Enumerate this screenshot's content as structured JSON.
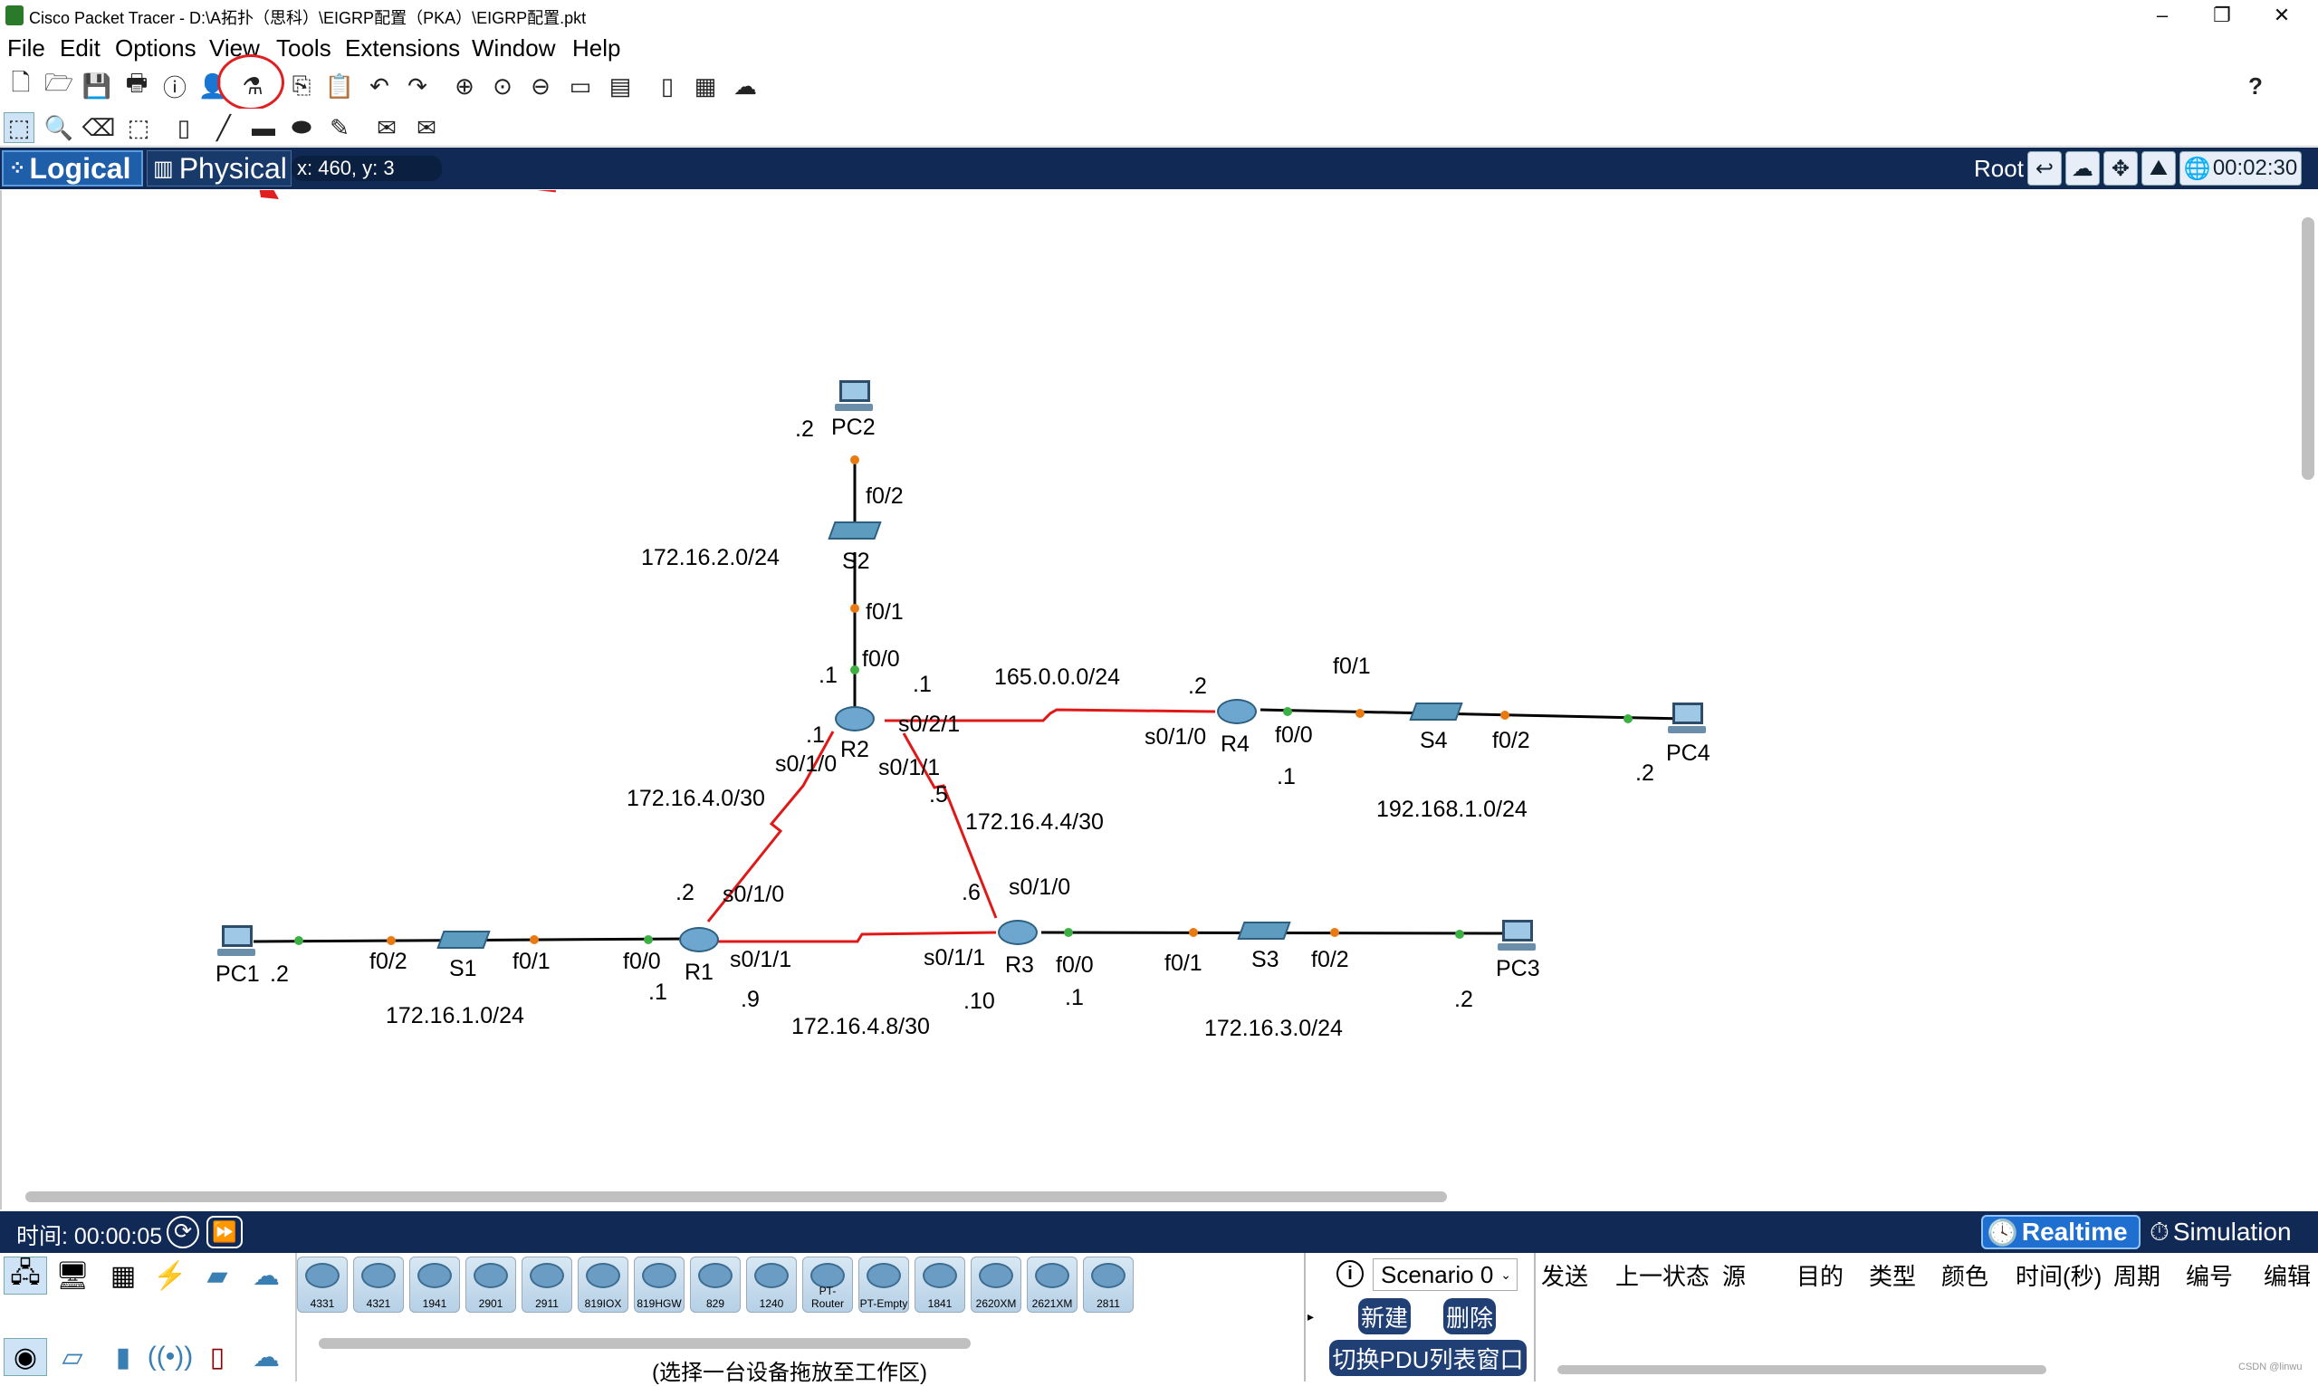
{
  "window": {
    "title": "Cisco Packet Tracer - D:\\A拓扑（思科）\\EIGRP配置（PKA）\\EIGRP配置.pkt",
    "minimize": "–",
    "restore": "❐",
    "close": "✕"
  },
  "menu": [
    "File",
    "Edit",
    "Options",
    "View",
    "Tools",
    "Extensions",
    "Window",
    "Help"
  ],
  "help_icon": "?",
  "modes": {
    "logical": "Logical",
    "physical": "Physical"
  },
  "coords": "x: 460, y: 3",
  "root_label": "Root",
  "clock": "00:02:30",
  "topology": {
    "devices": {
      "PC2": "PC2",
      "S2": "S2",
      "R2": "R2",
      "R4": "R4",
      "S4": "S4",
      "PC4": "PC4",
      "R1": "R1",
      "S1": "S1",
      "PC1": "PC1",
      "R3": "R3",
      "S3": "S3",
      "PC3": "PC3"
    },
    "labels": {
      "pc2_ip": ".2",
      "s2_f02": "f0/2",
      "net_2": "172.16.2.0/24",
      "s2_f01": "f0/1",
      "r2_f00": "f0/0",
      "r2_f00_ip": ".1",
      "r2_s021_ip": ".1",
      "net_165": "165.0.0.0/24",
      "r4_ip": ".2",
      "s4_f01": "f0/1",
      "r2_s021": "s0/2/1",
      "r2_s010_ip": ".1",
      "r2_s010": "s0/1/0",
      "r2_s011": "s0/1/1",
      "r4_s010": "s0/1/0",
      "r4_f00": "f0/0",
      "s4_f02": "f0/2",
      "pc4_ip": ".2",
      "r4_f00_ip": ".1",
      "net_192": "192.168.1.0/24",
      "net_4_0": "172.16.4.0/30",
      "r2_s011_ip": ".5",
      "net_4_4": "172.16.4.4/30",
      "r1_s010_ip": ".2",
      "r1_s010": "s0/1/0",
      "r3_s010_ip": ".6",
      "r3_s010": "s0/1/0",
      "pc1_ip": ".2",
      "s1_f02": "f0/2",
      "s1_f01": "f0/1",
      "r1_f00": "f0/0",
      "r1_s011": "s0/1/1",
      "r3_s011": "s0/1/1",
      "r3_f00": "f0/0",
      "s3_f01": "f0/1",
      "s3_f02": "f0/2",
      "r1_f00_ip": ".1",
      "r1_s011_ip": ".9",
      "r3_s011_ip": ".10",
      "r3_f00_ip": ".1",
      "pc3_ip": ".2",
      "net_1": "172.16.1.0/24",
      "net_4_8": "172.16.4.8/30",
      "net_3": "172.16.3.0/24"
    }
  },
  "timebar": {
    "time": "时间: 00:00:05",
    "realtime": "Realtime",
    "simulation": "Simulation"
  },
  "device_models": [
    "4331",
    "4321",
    "1941",
    "2901",
    "2911",
    "819IOX",
    "819HGW",
    "829",
    "1240",
    "PT-Router",
    "PT-Empty",
    "1841",
    "2620XM",
    "2621XM",
    "2811"
  ],
  "device_hint": "(选择一台设备拖放至工作区)",
  "pdu": {
    "scenario": "Scenario 0",
    "new": "新建",
    "delete": "删除",
    "toggle": "切换PDU列表窗口",
    "columns": [
      "发送",
      "上一状态",
      "源",
      "目的",
      "类型",
      "颜色",
      "时间(秒)",
      "周期",
      "编号",
      "编辑"
    ]
  },
  "watermark": "CSDN @linwu"
}
